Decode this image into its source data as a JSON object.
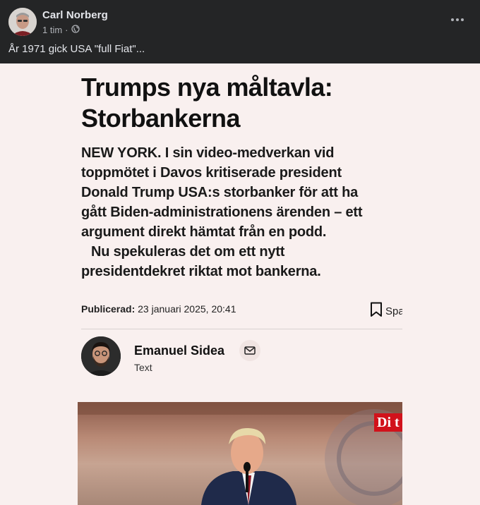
{
  "post": {
    "author": "Carl Norberg",
    "time": "1 tim",
    "separator": "·",
    "privacy_icon": "globe-icon",
    "text": "År 1971 gick USA \"full Fiat\"...",
    "more_icon": "more-options-icon"
  },
  "article": {
    "headline_line1": "Trumps nya måltavla:",
    "headline_line2": "Storbankerna",
    "lead_lines": [
      "NEW YORK. I sin video-medverkan vid",
      "toppmötet i Davos kritiserade president",
      "Donald Trump USA:s storbanker för att ha",
      "gått Biden-administrationens ärenden – ett",
      "argument direkt hämtat från en podd.",
      "Nu spekuleras det om ett nytt",
      "presidentdekret riktat mot bankerna."
    ],
    "published_label": "Publicerad:",
    "published_date": "23 januari 2025, 20:41",
    "save_label": "Spara",
    "author_name": "Emanuel Sidea",
    "author_role": "Text",
    "logo_text": "Di t"
  },
  "colors": {
    "background": "#242526",
    "article_bg": "#f9f0ef",
    "brand_red": "#d1121b"
  }
}
